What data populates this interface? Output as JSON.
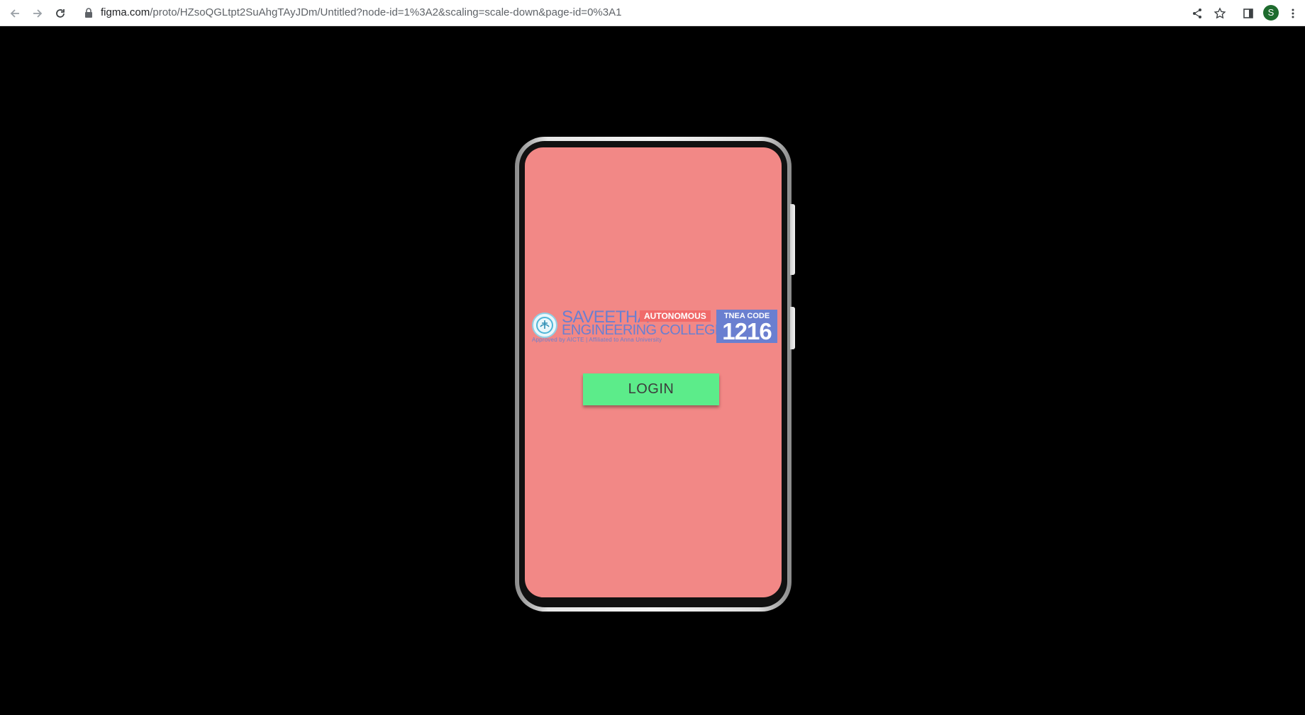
{
  "browser": {
    "url_host": "figma.com",
    "url_path": "/proto/HZsoQGLtpt2SuAhgTAyJDm/Untitled?node-id=1%3A2&scaling=scale-down&page-id=0%3A1",
    "profile_initial": "S",
    "icons": [
      "back-icon",
      "forward-icon",
      "reload-icon",
      "lock-icon",
      "share-icon",
      "star-icon",
      "side-panel-icon",
      "menu-icon"
    ]
  },
  "app": {
    "logo": {
      "name": "SAVEETHA",
      "subtitle": "ENGINEERING COLLEGE",
      "badge": "AUTONOMOUS",
      "approved": "Approved by AICTE  |  Affiliated to Anna University",
      "tnea_label": "TNEA CODE",
      "tnea_code": "1216"
    },
    "login_label": "LOGIN"
  },
  "colors": {
    "screen_background": "#f28886",
    "login_button": "#5cec8a",
    "logo_blue": "#6a7fd0",
    "badge_red": "#f06a6a"
  }
}
